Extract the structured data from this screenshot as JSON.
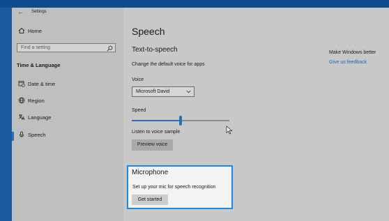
{
  "window": {
    "title": "Settings"
  },
  "sidebar": {
    "home": "Home",
    "search": {
      "placeholder": "Find a setting"
    },
    "section": "Time & Language",
    "items": [
      {
        "label": "Date & time",
        "icon": "calendar-clock-icon"
      },
      {
        "label": "Region",
        "icon": "globe-icon"
      },
      {
        "label": "Language",
        "icon": "language-icon"
      },
      {
        "label": "Speech",
        "icon": "microphone-icon",
        "selected": true
      }
    ]
  },
  "main": {
    "title": "Speech",
    "tts": {
      "heading": "Text-to-speech",
      "description": "Change the default voice for apps",
      "voice_label": "Voice",
      "voice_value": "Microsoft David",
      "speed_label": "Speed",
      "speed_fraction": 0.5,
      "listen_label": "Listen to voice sample",
      "preview_button": "Preview voice"
    },
    "microphone": {
      "heading": "Microphone",
      "description": "Set up your mic for speech recognition",
      "button": "Get started"
    }
  },
  "feedback": {
    "heading": "Make Windows better",
    "link": "Give us feedback"
  },
  "colors": {
    "accent": "#2a6fb5",
    "highlight_border": "#1e88e5",
    "link": "#1565c0"
  }
}
